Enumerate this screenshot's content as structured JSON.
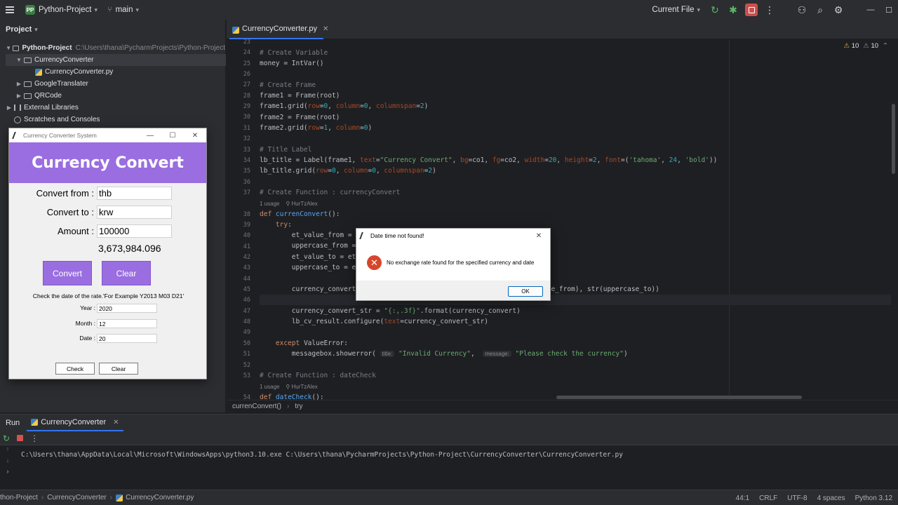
{
  "titlebar": {
    "project_badge": "PP",
    "project_name": "Python-Project",
    "branch_icon": "git-branch-icon",
    "branch": "main",
    "run_config": "Current File"
  },
  "project_panel": {
    "title": "Project",
    "root_name": "Python-Project",
    "root_path": "C:\\Users\\thana\\PycharmProjects\\Python-Project",
    "items": [
      {
        "label": "CurrencyConverter"
      },
      {
        "label": "CurrencyConverter.py"
      },
      {
        "label": "GoogleTranslater"
      },
      {
        "label": "QRCode"
      },
      {
        "label": "External Libraries"
      },
      {
        "label": "Scratches and Consoles"
      }
    ]
  },
  "editor": {
    "tab_label": "CurrencyConverter.py",
    "warnings": "10",
    "weak_warnings": "10",
    "usage_hint": "1 usage",
    "author_hint": "HurTzAlex",
    "line_numbers": [
      "23",
      "24",
      "25",
      "26",
      "27",
      "28",
      "29",
      "30",
      "31",
      "32",
      "33",
      "34",
      "35",
      "36",
      "37",
      "",
      "38",
      "39",
      "40",
      "41",
      "42",
      "43",
      "44",
      "45",
      "46",
      "47",
      "48",
      "49",
      "50",
      "51",
      "52",
      "53",
      "",
      "54"
    ],
    "breadcrumb": [
      "currenConvert()",
      "try"
    ]
  },
  "run_panel": {
    "title": "Run",
    "tab_label": "CurrencyConverter",
    "output": "C:\\Users\\thana\\AppData\\Local\\Microsoft\\WindowsApps\\python3.10.exe C:\\Users\\thana\\PycharmProjects\\Python-Project\\CurrencyConverter\\CurrencyConverter.py"
  },
  "statusbar": {
    "crumbs": [
      "thon-Project",
      "CurrencyConverter",
      "CurrencyConverter.py"
    ],
    "position": "44:1",
    "line_sep": "CRLF",
    "encoding": "UTF-8",
    "indent": "4 spaces",
    "interpreter": "Python 3.12"
  },
  "tk_window": {
    "title": "Currency Converter System",
    "banner": "Currency Convert",
    "convert_from_label": "Convert from :",
    "convert_from_value": "thb",
    "convert_to_label": "Convert to :",
    "convert_to_value": "krw",
    "amount_label": "Amount :",
    "amount_value": "100000",
    "result": "3,673,984.096",
    "convert_button": "Convert",
    "clear_button": "Clear",
    "check_label": "Check the date of the rate.'For Example Y2013 M03 D21'",
    "year_label": "Year :",
    "year_value": "2020",
    "month_label": "Month :",
    "month_value": "12",
    "date_label": "Date :",
    "date_value": "20",
    "check_button": "Check",
    "clear_small_button": "Clear"
  },
  "error_dialog": {
    "title": "Date time not found!",
    "message": "No exchange rate found for the specified currency and date",
    "ok_button": "OK"
  },
  "colors": {
    "accent": "#3574f0",
    "tk_purple": "#9a6ee0",
    "error_red": "#d6462b"
  }
}
